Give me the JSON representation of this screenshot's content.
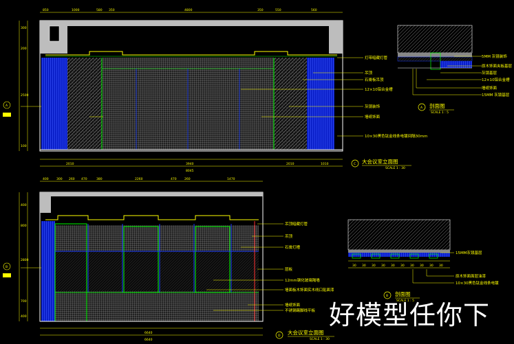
{
  "watermark": "好模型任你下",
  "top_elevation": {
    "title": "大会议室立面图",
    "scale": "SCALE 1 : 30",
    "sheet_no": "C",
    "overall_dim": "8045",
    "top_dims": [
      "850",
      "1000",
      "580",
      "350",
      "4800",
      "350",
      "550",
      "560"
    ],
    "bottom_dims": [
      "2010",
      "3940",
      "2010",
      "1010"
    ],
    "left_dims": [
      "300",
      "200",
      "2500",
      "100"
    ],
    "labels": [
      "灯带暗藏灯管",
      "吊顶",
      "石膏板吊顶",
      "12×10铝合金槽",
      "灰镜装饰",
      "墙纸饰面",
      "10×30黑色钛金线条电镀间隔30mm"
    ]
  },
  "top_section": {
    "title": "剖面图",
    "scale": "SCALE 1 : 5",
    "sheet_no": "A",
    "labels": [
      "5MM 灰镜装饰",
      "原木饰面夹板基层",
      "灰镜基层",
      "12×10铝合金槽",
      "墙纸饰面",
      "15MM 灰镜基层"
    ]
  },
  "bottom_elevation": {
    "title": "大会议室立面图",
    "scale": "SCALE 1 : 30",
    "sheet_no": "D",
    "overall_dim": "6640",
    "total_dim": "6640",
    "top_dims": [
      "400",
      "300",
      "260",
      "470",
      "380",
      "2260",
      "470",
      "260",
      "1470"
    ],
    "left_dims": [
      "400",
      "800",
      "2800",
      "700",
      "400"
    ],
    "labels": [
      "吊顶暗藏灯管",
      "吊顶",
      "石膏灯槽",
      "层板",
      "12mm钢化玻璃隔墙",
      "墙面板木饰面实木线口贴面漆",
      "墙纸饰面",
      "不锈钢踢脚线平板"
    ]
  },
  "bottom_section": {
    "title": "剖面图",
    "scale": "SCALE 1 : 5",
    "sheet_no": "B",
    "bar_dims": [
      "30",
      "30",
      "30",
      "30",
      "30",
      "30",
      "30",
      "30",
      "30",
      "30"
    ],
    "labels": [
      "15MM灰镜基层",
      "原木饰面面层油漆",
      "10×30黑色钛金线条电镀"
    ]
  }
}
